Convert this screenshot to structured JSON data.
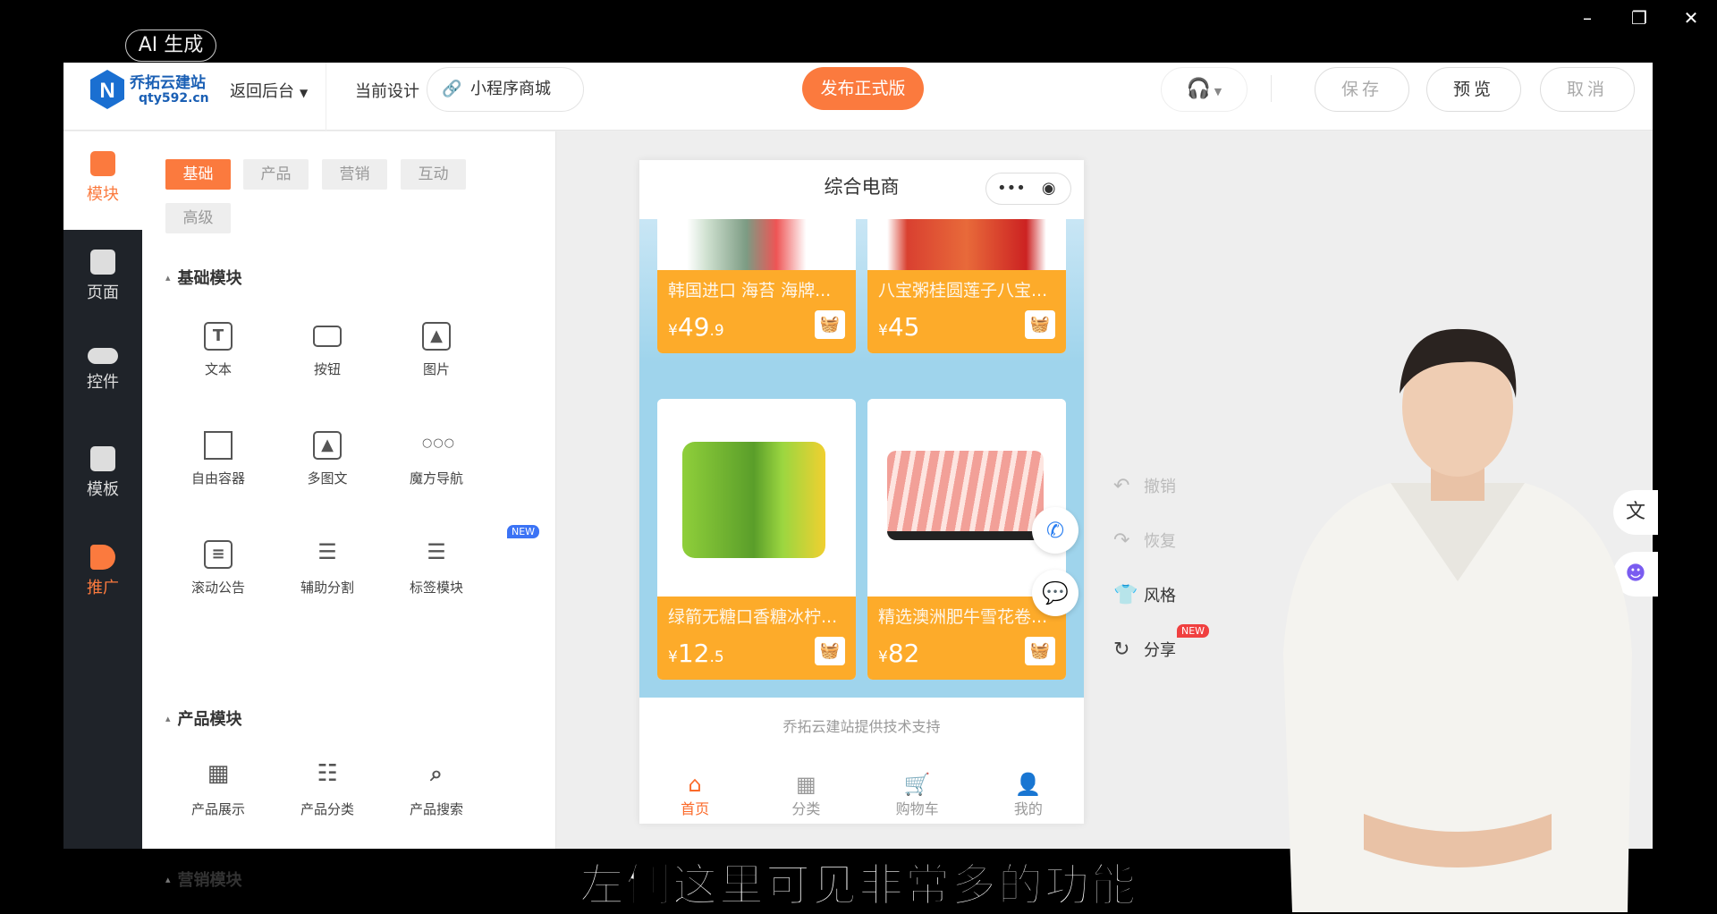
{
  "window": {
    "minimize": "–",
    "restore": "❐",
    "close": "✕"
  },
  "ai_badge": "AI 生成",
  "header": {
    "brand_name": "乔拓云建站",
    "brand_url": "qty592.cn",
    "back_label": "返回后台",
    "current_design_label": "当前设计",
    "design_name": "小程序商城",
    "publish_label": "发布正式版",
    "save_label": "保存",
    "preview_label": "预览",
    "cancel_label": "取消"
  },
  "rail": [
    {
      "label": "模块",
      "active": true
    },
    {
      "label": "页面"
    },
    {
      "label": "控件"
    },
    {
      "label": "模板"
    },
    {
      "label": "推广"
    }
  ],
  "panel": {
    "tabs": [
      "基础",
      "产品",
      "营销",
      "互动",
      "高级"
    ],
    "sections": [
      {
        "title": "基础模块",
        "items": [
          {
            "label": "文本",
            "icon": "text-icon"
          },
          {
            "label": "按钮",
            "icon": "button-icon"
          },
          {
            "label": "图片",
            "icon": "image-icon"
          },
          {
            "label": "自由容器",
            "icon": "container-icon"
          },
          {
            "label": "多图文",
            "icon": "multi-image-icon"
          },
          {
            "label": "魔方导航",
            "icon": "grid-dots-icon"
          },
          {
            "label": "滚动公告",
            "icon": "notice-icon"
          },
          {
            "label": "辅助分割",
            "icon": "divider-icon"
          },
          {
            "label": "标签模块",
            "icon": "tag-list-icon",
            "badge": "NEW"
          }
        ]
      },
      {
        "title": "产品模块",
        "items": [
          {
            "label": "产品展示",
            "icon": "product-grid-icon"
          },
          {
            "label": "产品分类",
            "icon": "category-icon"
          },
          {
            "label": "产品搜索",
            "icon": "product-search-icon"
          }
        ]
      },
      {
        "title": "营销模块",
        "items": []
      }
    ]
  },
  "phone": {
    "title": "综合电商",
    "products": [
      {
        "name": "韩国进口 海苔 海牌...",
        "price_int": "49",
        "price_dec": ".9"
      },
      {
        "name": "八宝粥桂圆莲子八宝...",
        "price_int": "45",
        "price_dec": ""
      },
      {
        "name": "绿箭无糖口香糖冰柠...",
        "price_int": "12",
        "price_dec": ".5"
      },
      {
        "name": "精选澳洲肥牛雪花卷...",
        "price_int": "82",
        "price_dec": ""
      }
    ],
    "currency": "¥",
    "footer": "乔拓云建站提供技术支持",
    "tabbar": [
      {
        "label": "首页",
        "icon": "home-icon",
        "active": true
      },
      {
        "label": "分类",
        "icon": "category-icon"
      },
      {
        "label": "购物车",
        "icon": "cart-icon"
      },
      {
        "label": "我的",
        "icon": "user-icon"
      }
    ]
  },
  "tools": {
    "undo": "撤销",
    "redo": "恢复",
    "style": "风格",
    "share": "分享",
    "share_badge": "NEW"
  },
  "subtitle": "左侧这里可见非常多的功能",
  "colors": {
    "accent": "#fb7a3e",
    "card": "#fdab2a",
    "rail": "#1f2329"
  }
}
